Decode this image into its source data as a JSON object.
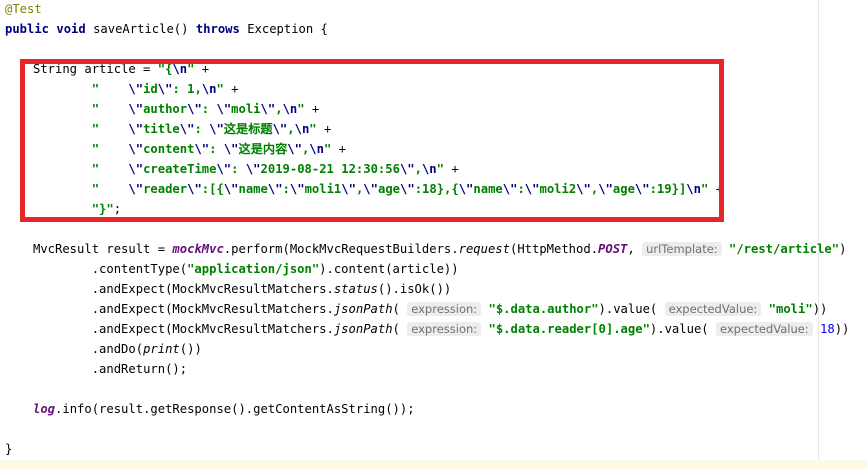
{
  "code": {
    "l1": {
      "annotation": "@Test"
    },
    "l2": {
      "kw1": "public",
      "kw2": "void",
      "name": "saveArticle()",
      "kw3": "throws",
      "rest": "Exception {"
    },
    "l3": {
      "prefix": "String article = ",
      "str1": "\"{",
      "esc": "\\n",
      "str2": "\"",
      "plus": " +"
    },
    "l4": {
      "indent": "        ",
      "q": "\"    ",
      "e1": "\\\"",
      "k": "id",
      "e2": "\\\"",
      "v": ": 1,",
      "e3": "\\n",
      "q2": "\"",
      "plus": " +"
    },
    "l5": {
      "indent": "        ",
      "q": "\"    ",
      "e1": "\\\"",
      "k": "author",
      "e2": "\\\"",
      "v1": ": ",
      "e3": "\\\"",
      "v2": "moli",
      "e4": "\\\"",
      "v3": ",",
      "e5": "\\n",
      "q2": "\"",
      "plus": " +"
    },
    "l6": {
      "indent": "        ",
      "q": "\"    ",
      "e1": "\\\"",
      "k": "title",
      "e2": "\\\"",
      "v1": ": ",
      "e3": "\\\"",
      "v2": "这是标题",
      "e4": "\\\"",
      "v3": ",",
      "e5": "\\n",
      "q2": "\"",
      "plus": " +"
    },
    "l7": {
      "indent": "        ",
      "q": "\"    ",
      "e1": "\\\"",
      "k": "content",
      "e2": "\\\"",
      "v1": ": ",
      "e3": "\\\"",
      "v2": "这是内容",
      "e4": "\\\"",
      "v3": ",",
      "e5": "\\n",
      "q2": "\"",
      "plus": " +"
    },
    "l8": {
      "indent": "        ",
      "q": "\"    ",
      "e1": "\\\"",
      "k": "createTime",
      "e2": "\\\"",
      "v1": ": ",
      "e3": "\\\"",
      "v2": "2019-08-21 12:30:56",
      "e4": "\\\"",
      "v3": ",",
      "e5": "\\n",
      "q2": "\"",
      "plus": " +"
    },
    "l9": {
      "indent": "        ",
      "q": "\"    ",
      "e1": "\\\"",
      "k": "reader",
      "e2": "\\\"",
      "v1": ":[{",
      "a1": "\\\"",
      "a2": "name",
      "a3": "\\\"",
      "a4": ":",
      "a5": "\\\"",
      "a6": "moli1",
      "a7": "\\\"",
      "a8": ",",
      "a9": "\\\"",
      "a10": "age",
      "a11": "\\\"",
      "a12": ":18},{",
      "b1": "\\\"",
      "b2": "name",
      "b3": "\\\"",
      "b4": ":",
      "b5": "\\\"",
      "b6": "moli2",
      "b7": "\\\"",
      "b8": ",",
      "b9": "\\\"",
      "b10": "age",
      "b11": "\\\"",
      "b12": ":19}]",
      "e5": "\\n",
      "q2": "\"",
      "plus": " +"
    },
    "l10": {
      "indent": "        ",
      "str": "\"}\"",
      "end": ";"
    },
    "l12": {
      "p1": "MvcResult result = ",
      "field": "mockMvc",
      "p2": ".perform(MockMvcRequestBuilders.",
      "m": "request",
      "p3": "(HttpMethod.",
      "c": "POST",
      "p4": ", ",
      "hint": "urlTemplate:",
      "str": "\"/rest/article\"",
      "p5": ")"
    },
    "l13": {
      "indent": "        ",
      "p1": ".contentType(",
      "str": "\"application/json\"",
      "p2": ").content(article))"
    },
    "l14": {
      "indent": "        ",
      "p1": ".andExpect(MockMvcResultMatchers.",
      "m": "status",
      "p2": "().isOk())"
    },
    "l15": {
      "indent": "        ",
      "p1": ".andExpect(MockMvcResultMatchers.",
      "m": "jsonPath",
      "p2": "( ",
      "hint1": "expression:",
      "str1": "\"$.data.author\"",
      "p3": ").value( ",
      "hint2": "expectedValue:",
      "str2": "\"moli\"",
      "p4": "))"
    },
    "l16": {
      "indent": "        ",
      "p1": ".andExpect(MockMvcResultMatchers.",
      "m": "jsonPath",
      "p2": "( ",
      "hint1": "expression:",
      "str1": "\"$.data.reader[0].age\"",
      "p3": ").value( ",
      "hint2": "expectedValue:",
      "num": "18",
      "p4": "))"
    },
    "l17": {
      "indent": "        ",
      "p1": ".andDo(",
      "m": "print",
      "p2": "())"
    },
    "l18": {
      "indent": "        ",
      "p1": ".andReturn();"
    },
    "l20": {
      "field": "log",
      "p1": ".info(result.getResponse().getContentAsString());"
    },
    "l22": {
      "brace": "}"
    }
  },
  "colors": {
    "highlight_box": "#e8262a",
    "keyword": "#000080",
    "string": "#008000",
    "annotation": "#808000",
    "field": "#660e7a",
    "number": "#0000ff"
  }
}
